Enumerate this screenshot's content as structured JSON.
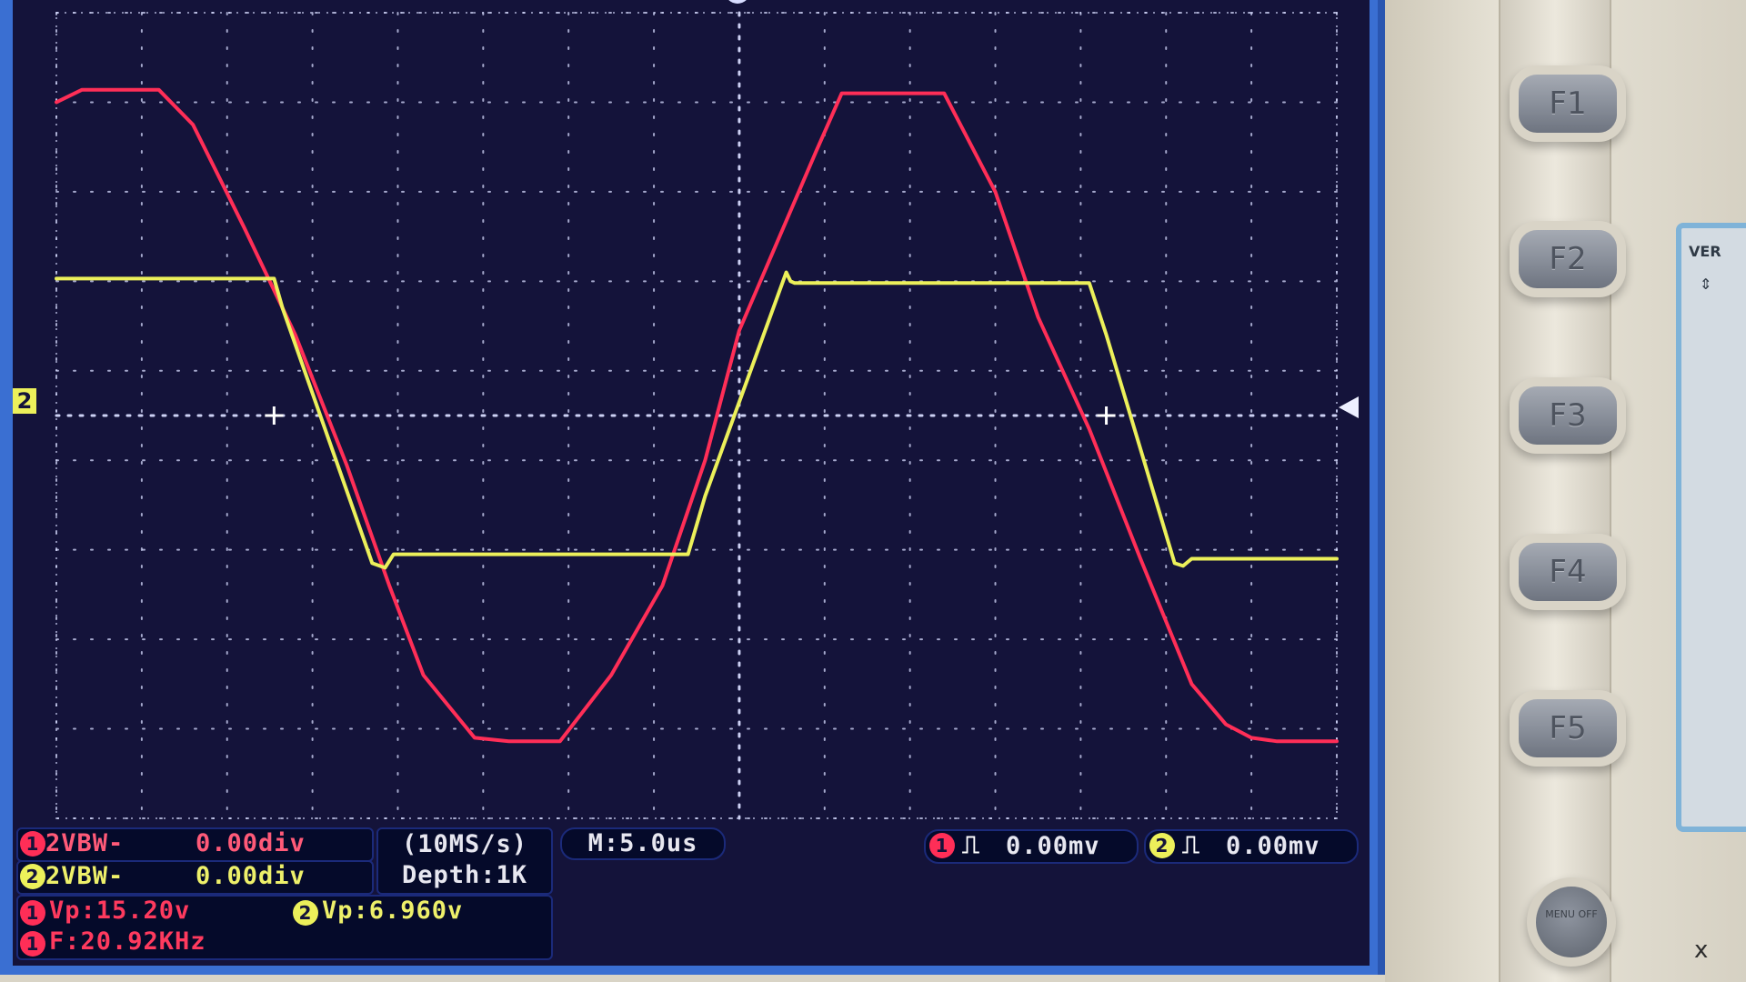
{
  "channel_markers": {
    "ch2_ground": "2",
    "ch1_label": "1",
    "ch2_label": "2"
  },
  "status": {
    "ch1_bw": "2VBW-",
    "ch1_pos": "0.00div",
    "ch2_bw": "2VBW-",
    "ch2_pos": "0.00div",
    "sample_rate": "(10MS/s)",
    "depth": "Depth:1K",
    "timebase": "M:5.0us",
    "trig1_level": "0.00mv",
    "trig2_level": "0.00mv",
    "ch1_vp": "Vp:15.20v",
    "ch2_vp": "Vp:6.960v",
    "ch1_freq": "F:20.92KHz"
  },
  "softkeys": [
    "F1",
    "F2",
    "F3",
    "F4",
    "F5"
  ],
  "panel": {
    "vertical_label": "VER",
    "x_label": "x",
    "round_button_label": "MENU OFF"
  },
  "colors": {
    "ch1": "#ff2e57",
    "ch2": "#ecf05a",
    "grid": "#d7dcff",
    "screen": "#14133a",
    "frame": "#3a6fd2"
  },
  "chart_data": {
    "type": "line",
    "title": "",
    "xlabel": "",
    "ylabel": "",
    "x_divisions": 15,
    "y_divisions": 9,
    "xlim": [
      0,
      15
    ],
    "ylim": [
      -4.5,
      4.5
    ],
    "series": [
      {
        "x": [
          0,
          0.3,
          0.6,
          1.2,
          1.6,
          2.2,
          2.8,
          3.4,
          3.9,
          4.3,
          4.9,
          5.3,
          5.9,
          6.5,
          7.1,
          7.6,
          8.0,
          8.9,
          9.2,
          9.8,
          10.4,
          11.0,
          11.5,
          12.1,
          12.7,
          13.3,
          13.7,
          14.0,
          14.3,
          14.6,
          15.0
        ],
        "y": [
          3.5,
          3.64,
          3.64,
          3.64,
          3.25,
          2.1,
          0.9,
          -0.55,
          -1.9,
          -2.9,
          -3.6,
          -3.64,
          -3.64,
          -2.9,
          -1.9,
          -0.5,
          0.95,
          2.95,
          3.6,
          3.6,
          3.6,
          2.5,
          1.1,
          -0.15,
          -1.6,
          -3.0,
          -3.45,
          -3.6,
          -3.64,
          -3.64,
          -3.64
        ]
      },
      {
        "x": [
          0,
          2.55,
          2.65,
          3.7,
          3.85,
          3.95,
          4.0,
          7.4,
          7.6,
          8.55,
          8.6,
          8.65,
          12.1,
          12.3,
          13.1,
          13.2,
          13.3,
          15.0
        ],
        "y": [
          1.53,
          1.53,
          1.2,
          -1.65,
          -1.7,
          -1.55,
          -1.55,
          -1.55,
          -0.9,
          1.6,
          1.5,
          1.48,
          1.48,
          0.9,
          -1.65,
          -1.68,
          -1.6,
          -1.6
        ]
      }
    ]
  }
}
